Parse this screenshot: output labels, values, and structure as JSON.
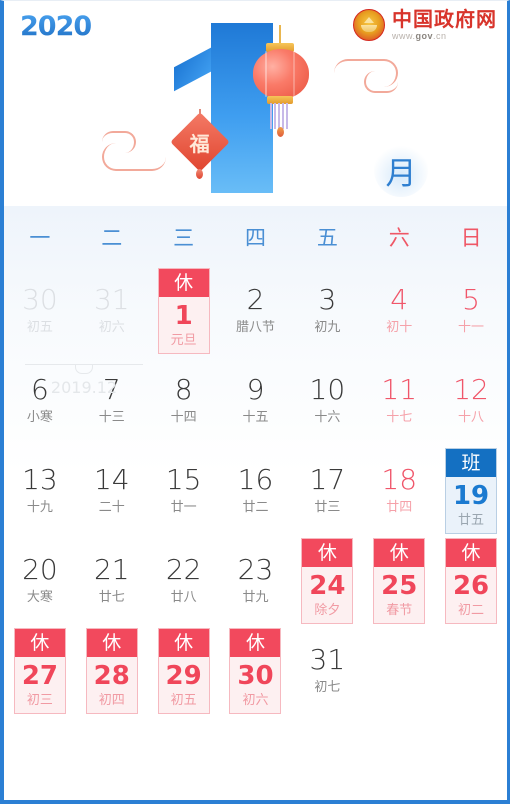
{
  "header": {
    "year_logo": "2020",
    "gov_site_name": "中国政府网",
    "gov_site_url_prefix": "www.",
    "gov_site_url_main": "gov",
    "gov_site_url_suffix": ".cn",
    "month_glyph": "月",
    "fu_character": "福",
    "emblem_name": "national-emblem-icon"
  },
  "calendar": {
    "weekdays": [
      {
        "label": "一",
        "weekend": false
      },
      {
        "label": "二",
        "weekend": false
      },
      {
        "label": "三",
        "weekend": false
      },
      {
        "label": "四",
        "weekend": false
      },
      {
        "label": "五",
        "weekend": false
      },
      {
        "label": "六",
        "weekend": true
      },
      {
        "label": "日",
        "weekend": true
      }
    ],
    "prev_month_label": "2019.12",
    "rest_tag": "休",
    "work_tag": "班",
    "weeks": [
      [
        {
          "num": "30",
          "lunar": "初五",
          "style": "muted"
        },
        {
          "num": "31",
          "lunar": "初六",
          "style": "muted"
        },
        {
          "num": "1",
          "lunar": "元旦",
          "style": "rest"
        },
        {
          "num": "2",
          "lunar": "腊八节",
          "style": "normal"
        },
        {
          "num": "3",
          "lunar": "初九",
          "style": "normal"
        },
        {
          "num": "4",
          "lunar": "初十",
          "style": "red"
        },
        {
          "num": "5",
          "lunar": "十一",
          "style": "red"
        }
      ],
      [
        {
          "num": "6",
          "lunar": "小寒",
          "style": "normal"
        },
        {
          "num": "7",
          "lunar": "十三",
          "style": "normal"
        },
        {
          "num": "8",
          "lunar": "十四",
          "style": "normal"
        },
        {
          "num": "9",
          "lunar": "十五",
          "style": "normal"
        },
        {
          "num": "10",
          "lunar": "十六",
          "style": "normal"
        },
        {
          "num": "11",
          "lunar": "十七",
          "style": "red"
        },
        {
          "num": "12",
          "lunar": "十八",
          "style": "red"
        }
      ],
      [
        {
          "num": "13",
          "lunar": "十九",
          "style": "normal"
        },
        {
          "num": "14",
          "lunar": "二十",
          "style": "normal"
        },
        {
          "num": "15",
          "lunar": "廿一",
          "style": "normal"
        },
        {
          "num": "16",
          "lunar": "廿二",
          "style": "normal"
        },
        {
          "num": "17",
          "lunar": "廿三",
          "style": "normal"
        },
        {
          "num": "18",
          "lunar": "廿四",
          "style": "red"
        },
        {
          "num": "19",
          "lunar": "廿五",
          "style": "work"
        }
      ],
      [
        {
          "num": "20",
          "lunar": "大寒",
          "style": "normal"
        },
        {
          "num": "21",
          "lunar": "廿七",
          "style": "normal"
        },
        {
          "num": "22",
          "lunar": "廿八",
          "style": "normal"
        },
        {
          "num": "23",
          "lunar": "廿九",
          "style": "normal"
        },
        {
          "num": "24",
          "lunar": "除夕",
          "style": "rest"
        },
        {
          "num": "25",
          "lunar": "春节",
          "style": "rest"
        },
        {
          "num": "26",
          "lunar": "初二",
          "style": "rest"
        }
      ],
      [
        {
          "num": "27",
          "lunar": "初三",
          "style": "rest"
        },
        {
          "num": "28",
          "lunar": "初四",
          "style": "rest"
        },
        {
          "num": "29",
          "lunar": "初五",
          "style": "rest"
        },
        {
          "num": "30",
          "lunar": "初六",
          "style": "rest"
        },
        {
          "num": "31",
          "lunar": "初七",
          "style": "normal"
        },
        {
          "num": "",
          "lunar": "",
          "style": "empty"
        },
        {
          "num": "",
          "lunar": "",
          "style": "empty"
        }
      ]
    ]
  },
  "colors": {
    "accent_blue": "#2b7fd4",
    "rest_red": "#f2495d",
    "work_blue": "#1470c2",
    "weekend_red": "#f0566a",
    "muted_gray": "#dcdfe3"
  }
}
